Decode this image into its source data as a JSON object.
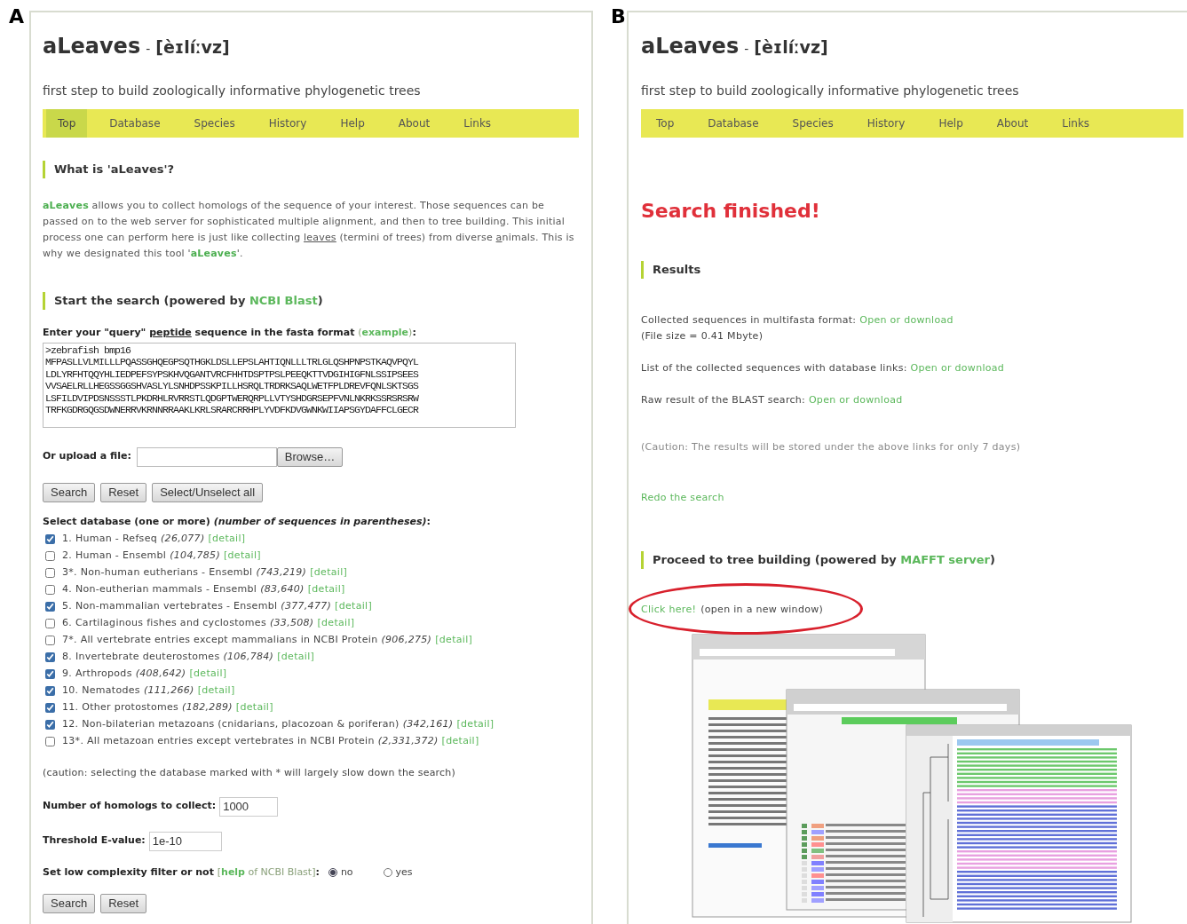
{
  "panel_a": {
    "label": "A",
    "title": "aLeaves",
    "separator": "-",
    "pronunciation": "[èɪlíːvz]",
    "tagline": "first step to build zoologically informative phylogenetic trees",
    "nav": [
      {
        "label": "Top",
        "selected": true
      },
      {
        "label": "Database",
        "selected": false
      },
      {
        "label": "Species",
        "selected": false
      },
      {
        "label": "History",
        "selected": false
      },
      {
        "label": "Help",
        "selected": false
      },
      {
        "label": "About",
        "selected": false
      },
      {
        "label": "Links",
        "selected": false
      }
    ],
    "intro_heading": "What is 'aLeaves'?",
    "intro_text": [
      {
        "kind": "accent",
        "text": "aLeaves"
      },
      {
        "kind": "plain",
        "text": " allows you to collect homologs of the sequence of your interest. Those sequences can be passed on to the web server for sophisticated multiple alignment, and then to tree building. This initial process one can perform here is just like collecting "
      },
      {
        "kind": "underline",
        "text": "leaves"
      },
      {
        "kind": "plain",
        "text": " (termini of trees) from diverse "
      },
      {
        "kind": "underline",
        "text": "a"
      },
      {
        "kind": "plain",
        "text": "nimals. This is why we designated this tool '"
      },
      {
        "kind": "accent",
        "text": "aLeaves"
      },
      {
        "kind": "plain",
        "text": "'."
      }
    ],
    "search_heading": [
      {
        "kind": "plain",
        "text": "Start the search (powered by "
      },
      {
        "kind": "link",
        "text": "NCBI Blast"
      },
      {
        "kind": "plain",
        "text": ")"
      }
    ],
    "query_label": [
      {
        "kind": "plain",
        "text": "Enter your \"query\" "
      },
      {
        "kind": "underline",
        "text": "peptide"
      },
      {
        "kind": "plain",
        "text": " sequence in the fasta format "
      },
      {
        "kind": "muted",
        "text": "("
      },
      {
        "kind": "link",
        "text": "example"
      },
      {
        "kind": "muted",
        "text": ")"
      },
      {
        "kind": "plain",
        "text": ":"
      }
    ],
    "query_value": ">zebrafish bmp16\nMFPASLLVLMILLLPQASSGHQEGPSQTHGKLDSLLEPSLAHTIQNLLLTRLGLQSHPNPSTKAQVPQYL\nLDLYRFHTQQYHLIEDPEFSYPSKHVQGANTVRCFHHTDSPTPSLPEEQKTTVDGIHIGFNLSSIPSEES\nVVSAELRLLHEGSSGGSHVASLYLSNHDPSSKPILLHSRQLTRDRKSAQLWETFPLDREVFQNLSKTSGS\nLSFILDVIPDSNSSSTLPKDRHLRVRRSTLQDGPTWERQRPLLVTYSHDGRSEPFVNLNKRKSSRSRSRW\nTRFKGDRGQGSDWNERRVKRNNRRAAKLKRLSRARCRRHPLYVDFKDVGWNKWIIAPSGYDAFFCLGECR",
    "upload_label": "Or upload a file:",
    "browse_button": "Browse…",
    "buttons": [
      "Search",
      "Reset",
      "Select/Unselect all"
    ],
    "database_heading": "Select database (one or more) *(number of sequences in parentheses)*:",
    "databases": [
      {
        "name": "1. Human - Refseq",
        "count": "(26,077)",
        "link": "[detail]",
        "checked": true
      },
      {
        "name": "2. Human - Ensembl",
        "count": "(104,785)",
        "link": "[detail]",
        "checked": false
      },
      {
        "name": "3*. Non-human eutherians - Ensembl",
        "count": "(743,219)",
        "link": "[detail]",
        "checked": false
      },
      {
        "name": "4. Non-eutherian mammals - Ensembl",
        "count": "(83,640)",
        "link": "[detail]",
        "checked": false
      },
      {
        "name": "5. Non-mammalian vertebrates - Ensembl",
        "count": "(377,477)",
        "link": "[detail]",
        "checked": true
      },
      {
        "name": "6. Cartilaginous fishes and cyclostomes",
        "count": "(33,508)",
        "link": "[detail]",
        "checked": false
      },
      {
        "name": "7*. All vertebrate entries except mammalians in NCBI Protein",
        "count": "(906,275)",
        "link": "[detail]",
        "checked": false
      },
      {
        "name": "8. Invertebrate deuterostomes",
        "count": "(106,784)",
        "link": "[detail]",
        "checked": true
      },
      {
        "name": "9. Arthropods",
        "count": "(408,642)",
        "link": "[detail]",
        "checked": true
      },
      {
        "name": "10. Nematodes",
        "count": "(111,266)",
        "link": "[detail]",
        "checked": true
      },
      {
        "name": "11. Other protostomes",
        "count": "(182,289)",
        "link": "[detail]",
        "checked": true
      },
      {
        "name": "12. Non-bilaterian metazoans (cnidarians, placozoan & poriferan)",
        "count": "(342,161)",
        "link": "[detail]",
        "checked": true
      },
      {
        "name": "13*. All metazoan entries except vertebrates in NCBI Protein",
        "count": "(2,331,372)",
        "link": "[detail]",
        "checked": false
      }
    ],
    "caution": "(caution: selecting the database marked with * will largely slow down the search)",
    "homologs": {
      "label": "Number of homologs to collect:",
      "value": "1000"
    },
    "evalue": {
      "label": "Threshold E-value:",
      "value": "1e-10"
    },
    "filter_label": [
      {
        "kind": "plain",
        "text": "Set low complexity filter or not "
      },
      {
        "kind": "muted",
        "text": "["
      },
      {
        "kind": "link",
        "text": "help"
      },
      {
        "kind": "muted",
        "text": " of NCBI Blast]"
      },
      {
        "kind": "plain",
        "text": ":"
      }
    ],
    "filter_options": [
      {
        "label": "no",
        "selected": true
      },
      {
        "label": "yes",
        "selected": false
      }
    ],
    "bottom_buttons": [
      "Search",
      "Reset"
    ]
  },
  "panel_b": {
    "label": "B",
    "title": "aLeaves",
    "separator": "-",
    "pronunciation": "[èɪlíːvz]",
    "tagline": "first step to build zoologically informative phylogenetic trees",
    "nav": [
      {
        "label": "Top",
        "selected": false
      },
      {
        "label": "Database",
        "selected": false
      },
      {
        "label": "Species",
        "selected": false
      },
      {
        "label": "History",
        "selected": false
      },
      {
        "label": "Help",
        "selected": false
      },
      {
        "label": "About",
        "selected": false
      },
      {
        "label": "Links",
        "selected": false
      }
    ],
    "status": "Search finished!",
    "results_heading": "Results",
    "results": [
      {
        "text": "Collected sequences in multifasta format:",
        "link": "Open or download",
        "note": "(File size = 0.41 Mbyte)"
      },
      {
        "text": "List of the collected sequences with database links:",
        "link": "Open or download"
      },
      {
        "text": "Raw result of the BLAST search:",
        "link": "Open or download"
      }
    ],
    "caution": "(Caution: The results will be stored under the above links for only 7 days)",
    "redo_link": "Redo the search",
    "tree_heading": [
      {
        "kind": "plain",
        "text": "Proceed to tree building (powered by "
      },
      {
        "kind": "link",
        "text": "MAFFT server"
      },
      {
        "kind": "plain",
        "text": ")"
      }
    ],
    "click_link": "Click here!",
    "click_note": "(open in a new window)",
    "circled": true
  }
}
